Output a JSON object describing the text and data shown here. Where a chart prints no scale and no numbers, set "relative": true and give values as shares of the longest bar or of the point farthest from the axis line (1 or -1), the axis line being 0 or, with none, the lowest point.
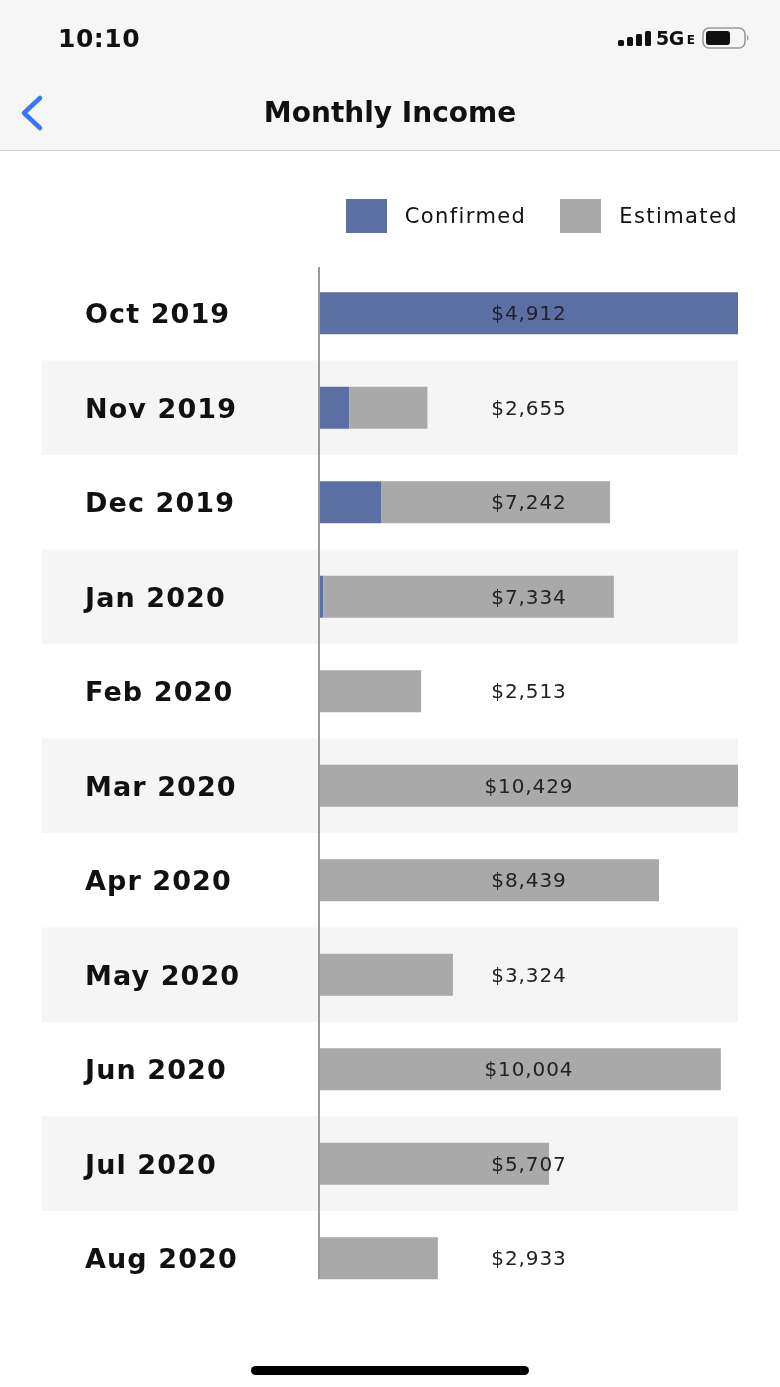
{
  "status_bar": {
    "time": "10:10",
    "network": "5G",
    "network_badge": "E"
  },
  "nav_bar": {
    "title": "Monthly Income"
  },
  "income_chart": {
    "chart_data": {
      "type": "bar",
      "orientation": "horizontal",
      "stacked": true,
      "relative": true,
      "legend": "upper right",
      "categories": [
        "Oct 2019",
        "Nov 2019",
        "Dec 2019",
        "Jan 2020",
        "Feb 2020",
        "Mar 2020",
        "Apr 2020",
        "May 2020",
        "Jun 2020",
        "Jul 2020",
        "Aug 2020"
      ],
      "series": [
        {
          "name": "Confirmed",
          "color": "#5b6fa5",
          "values": [
            1.0,
            0.07,
            0.146,
            0.008,
            null,
            null,
            null,
            null,
            null,
            null,
            null
          ]
        },
        {
          "name": "Estimated",
          "color": "#a9a9a9",
          "values": [
            null,
            0.187,
            0.548,
            0.695,
            0.242,
            1.0,
            0.811,
            0.318,
            0.959,
            0.548,
            0.282
          ]
        }
      ],
      "value_labels": [
        "$4,912",
        "$2,655",
        "$7,242",
        "$7,334",
        "$2,513",
        "$10,429",
        "$8,439",
        "$3,324",
        "$10,004",
        "$5,707",
        "$2,933"
      ]
    }
  }
}
